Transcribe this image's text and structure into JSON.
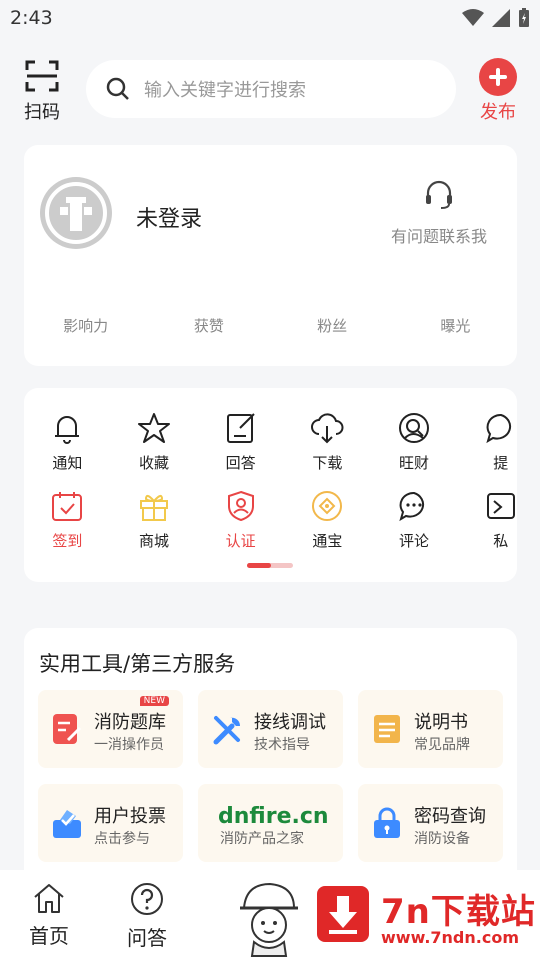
{
  "status_bar": {
    "time": "2:43"
  },
  "header": {
    "scan_label": "扫码",
    "search_placeholder": "输入关键字进行搜索",
    "publish_label": "发布"
  },
  "profile": {
    "login_status": "未登录",
    "contact_label": "有问题联系我",
    "stats": [
      "影响力",
      "获赞",
      "粉丝",
      "曝光"
    ]
  },
  "menu": {
    "row1": [
      "通知",
      "收藏",
      "回答",
      "下载",
      "旺财",
      "提"
    ],
    "row2": [
      "签到",
      "商城",
      "认证",
      "通宝",
      "评论",
      "私"
    ]
  },
  "tools": {
    "section_title": "实用工具/第三方服务",
    "items": [
      {
        "title": "消防题库",
        "subtitle": "一消操作员",
        "badge": "NEW"
      },
      {
        "title": "接线调试",
        "subtitle": "技术指导"
      },
      {
        "title": "说明书",
        "subtitle": "常见品牌"
      },
      {
        "title": "用户投票",
        "subtitle": "点击参与"
      },
      {
        "title": "dnfire.cn",
        "subtitle": "消防产品之家"
      },
      {
        "title": "密码查询",
        "subtitle": "消防设备"
      }
    ]
  },
  "bottom_nav": {
    "home": "首页",
    "qa": "问答"
  },
  "watermark": {
    "title": "7n下载站",
    "url": "www.7ndn.com"
  },
  "colors": {
    "accent": "#e84545",
    "background": "#f5f6f8",
    "tool_bg": "#fdf8ef"
  }
}
